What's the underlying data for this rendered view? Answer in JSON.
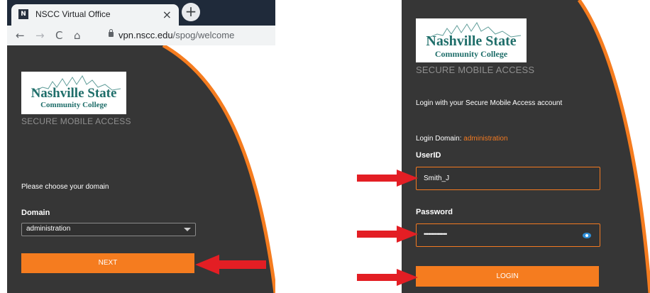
{
  "left": {
    "tab": {
      "favicon_glyph": "N",
      "title": "NSCC Virtual Office",
      "close_glyph": "×",
      "new_tab_glyph": "+"
    },
    "nav": {
      "back_glyph": "←",
      "forward_glyph": "→",
      "reload_glyph": "C",
      "home_glyph": "⌂"
    },
    "url": {
      "host": "vpn.nscc.edu",
      "path": "/spog/welcome"
    },
    "logo": {
      "line1": "Nashville State",
      "line2": "Community College"
    },
    "subtitle": "SECURE MOBILE ACCESS",
    "prompt": "Please choose your domain",
    "domain_label": "Domain",
    "domain_value": "administration",
    "next_button": "NEXT"
  },
  "right": {
    "logo": {
      "line1": "Nashville State",
      "line2": "Community College"
    },
    "subtitle": "SECURE MOBILE ACCESS",
    "login_intro": "Login with your Secure Mobile Access account",
    "login_domain_label": "Login Domain:",
    "login_domain_value": "administration",
    "userid_label": "UserID",
    "userid_value": "Smith_J",
    "password_label": "Password",
    "password_value": "•••••••••••••••",
    "login_button": "LOGIN"
  },
  "colors": {
    "accent": "#f57c1f",
    "panel": "#363636",
    "arrow": "#e31e24",
    "logo_text": "#1f6e6a"
  },
  "icons": [
    "favicon-icon",
    "close-icon",
    "new-tab-icon",
    "back-icon",
    "forward-icon",
    "reload-icon",
    "home-icon",
    "lock-icon",
    "chevron-down-icon",
    "eye-icon",
    "arrow-icon"
  ]
}
